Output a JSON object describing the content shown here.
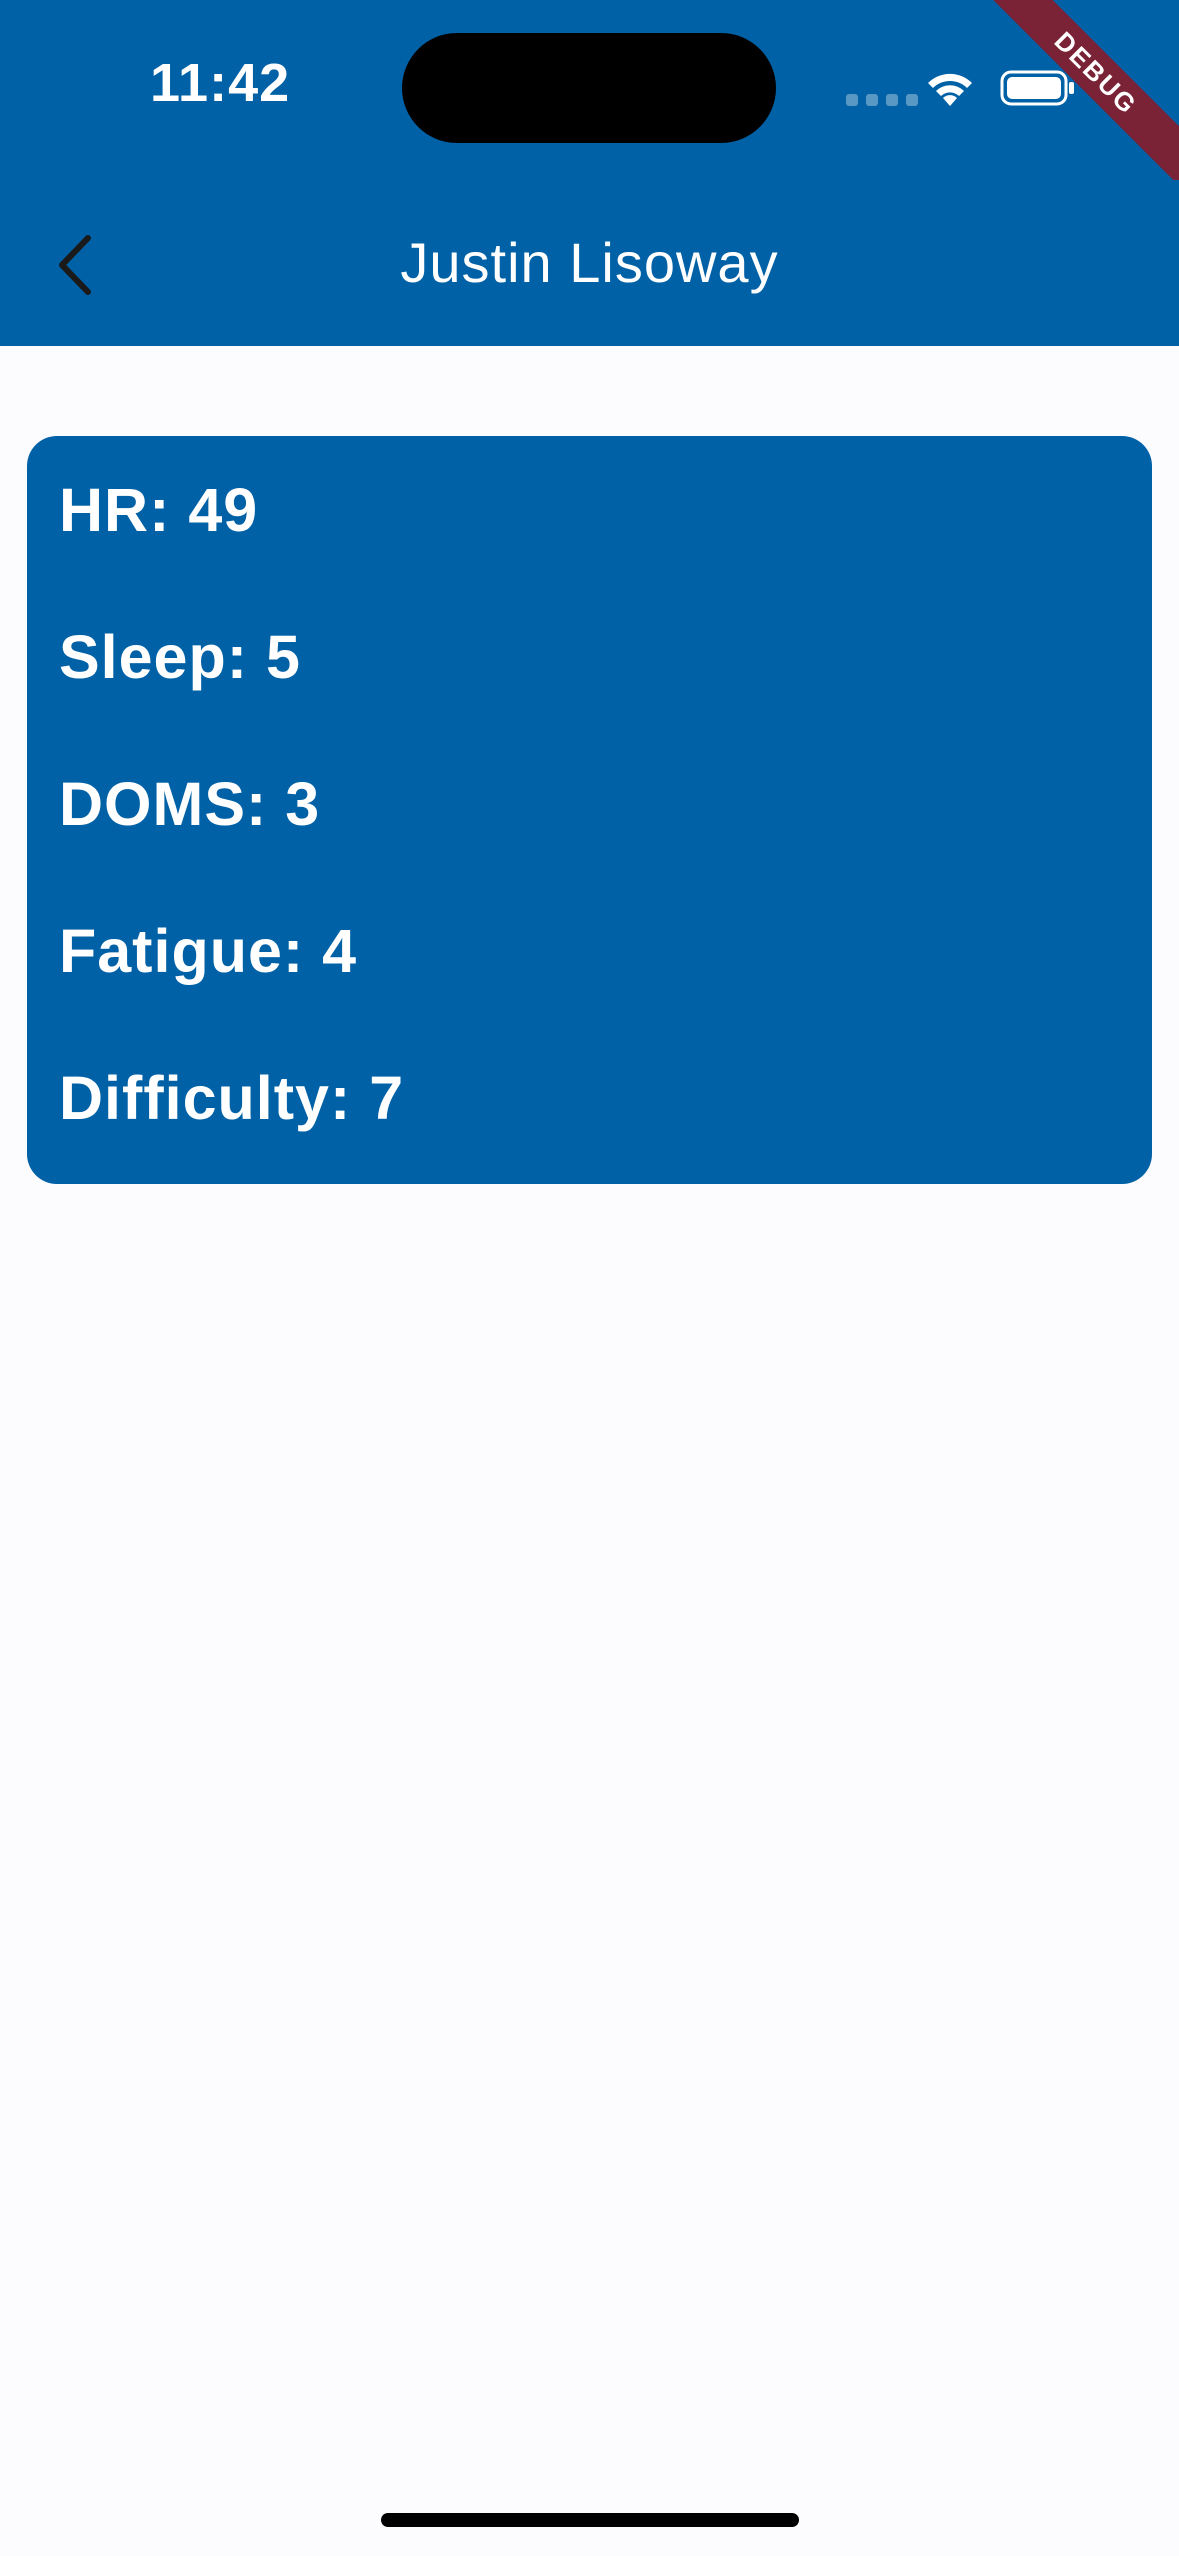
{
  "status_bar": {
    "time": "11:42",
    "background_color": "#0061a6",
    "icons": [
      "cellular-signal-icon",
      "wifi-icon",
      "battery-icon"
    ]
  },
  "debug_banner": {
    "label": "DEBUG",
    "color": "#7a2236"
  },
  "app_bar": {
    "title": "Justin Lisoway",
    "back_icon": "chevron-left-icon",
    "background_color": "#0061a6"
  },
  "stats_card": {
    "background_color": "#0061a6",
    "rows": [
      {
        "text": "HR: 49"
      },
      {
        "text": "Sleep: 5"
      },
      {
        "text": "DOMS: 3"
      },
      {
        "text": "Fatigue: 4"
      },
      {
        "text": "Difficulty: 7"
      }
    ]
  }
}
